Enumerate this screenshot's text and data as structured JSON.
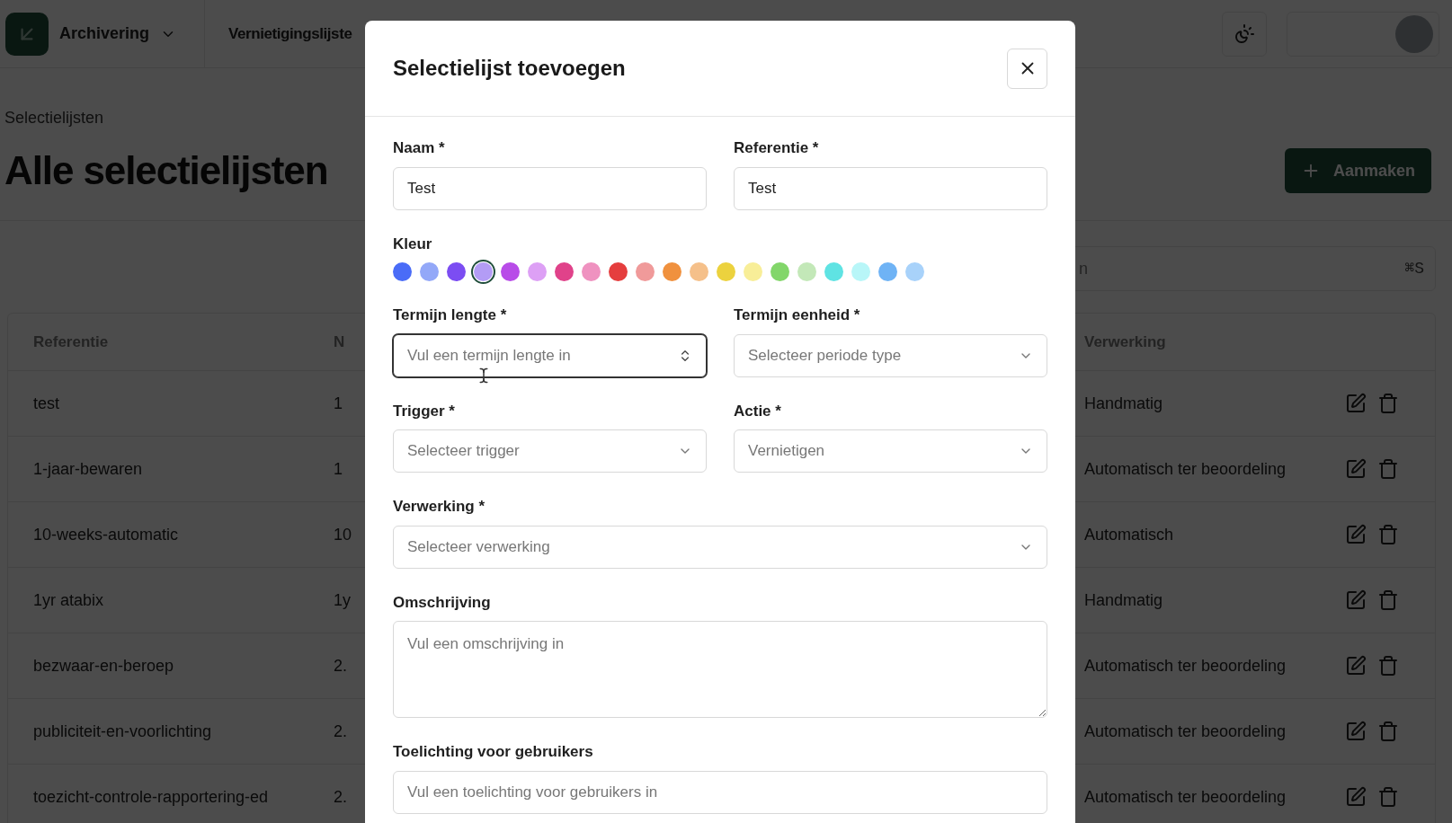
{
  "header": {
    "app_menu": {
      "label": "Archivering"
    },
    "nav": [
      {
        "label": "Vernietigingslijste"
      }
    ]
  },
  "breadcrumb": "Selectielijsten",
  "page_title": "Alle selectielijsten",
  "create_button": {
    "label": "Aanmaken"
  },
  "search": {
    "placeholder": "n",
    "shortcut": "⌘S"
  },
  "table": {
    "columns": [
      "Referentie",
      "N",
      "Verwerking"
    ],
    "rows": [
      {
        "reference": "test",
        "column_2": "1",
        "processing": "Handmatig"
      },
      {
        "reference": "1-jaar-bewaren",
        "column_2": "1",
        "processing": "Automatisch ter beoordeling"
      },
      {
        "reference": "10-weeks-automatic",
        "column_2": "10",
        "processing": "Automatisch"
      },
      {
        "reference": "1yr atabix",
        "column_2": "1y",
        "processing": "Handmatig"
      },
      {
        "reference": "bezwaar-en-beroep",
        "column_2": "2.",
        "processing": "Automatisch ter beoordeling"
      },
      {
        "reference": "publiciteit-en-voorlichting",
        "column_2": "2.",
        "processing": "Automatisch ter beoordeling"
      },
      {
        "reference": "toezicht-controle-rapportering-ed",
        "column_2": "2.",
        "processing": "Automatisch ter beoordeling"
      }
    ]
  },
  "modal": {
    "title": "Selectielijst toevoegen",
    "rows": [
      [
        {
          "kind": "text",
          "label": "Naam *",
          "value": "Test"
        },
        {
          "kind": "text",
          "label": "Referentie *",
          "value": "Test"
        }
      ],
      [
        {
          "kind": "color",
          "label": "Kleur",
          "swatches": [
            {
              "color": "#4a6cf7",
              "selected": false
            },
            {
              "color": "#93a8f8",
              "selected": false
            },
            {
              "color": "#7c4df2",
              "selected": false
            },
            {
              "color": "#b39cf5",
              "selected": true
            },
            {
              "color": "#b84ce8",
              "selected": false
            },
            {
              "color": "#dda0f5",
              "selected": false
            },
            {
              "color": "#e0428a",
              "selected": false
            },
            {
              "color": "#ef92c0",
              "selected": false
            },
            {
              "color": "#e53e3e",
              "selected": false
            },
            {
              "color": "#f09a9a",
              "selected": false
            },
            {
              "color": "#f0913e",
              "selected": false
            },
            {
              "color": "#f5c08a",
              "selected": false
            },
            {
              "color": "#ecd23e",
              "selected": false
            },
            {
              "color": "#f8ee98",
              "selected": false
            },
            {
              "color": "#82d66a",
              "selected": false
            },
            {
              "color": "#c3e8b8",
              "selected": false
            },
            {
              "color": "#5fe3e3",
              "selected": false
            },
            {
              "color": "#b8f6f8",
              "selected": false
            },
            {
              "color": "#6fb3f5",
              "selected": false
            },
            {
              "color": "#a8d2fa",
              "selected": false
            }
          ]
        }
      ],
      [
        {
          "kind": "number",
          "label": "Termijn lengte *",
          "placeholder": "Vul een termijn lengte in",
          "focused": true
        },
        {
          "kind": "select",
          "label": "Termijn eenheid *",
          "placeholder": "Selecteer periode type"
        }
      ],
      [
        {
          "kind": "select",
          "label": "Trigger *",
          "placeholder": "Selecteer trigger"
        },
        {
          "kind": "select",
          "label": "Actie *",
          "placeholder": "Vernietigen"
        }
      ],
      [
        {
          "kind": "select",
          "label": "Verwerking *",
          "placeholder": "Selecteer verwerking"
        }
      ],
      [
        {
          "kind": "textarea",
          "label": "Omschrijving",
          "placeholder": "Vul een omschrijving in"
        }
      ],
      [
        {
          "kind": "text",
          "label": "Toelichting voor gebruikers",
          "placeholder": "Vul een toelichting voor gebruikers in"
        }
      ]
    ]
  }
}
